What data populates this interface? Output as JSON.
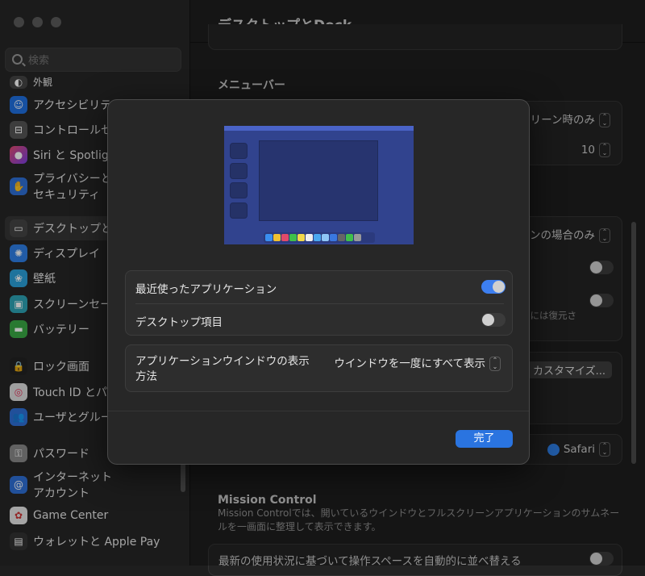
{
  "window": {
    "title": "デスクトップとDock"
  },
  "sidebar": {
    "search_placeholder": "検索",
    "items": [
      {
        "label": "外観",
        "icon": "appearance-icon",
        "color": "#444"
      },
      {
        "label": "アクセシビリティ",
        "icon": "accessibility-icon",
        "color": "#1f6fe0"
      },
      {
        "label": "コントロールセンター",
        "icon": "control-center-icon",
        "color": "#555"
      },
      {
        "label": "Siri と Spotlight",
        "icon": "siri-icon",
        "color": "#c43aa6"
      },
      {
        "label_line1": "プライバシーと",
        "label_line2": "セキュリティ",
        "icon": "hand-icon",
        "color": "#2f6fd6"
      },
      {
        "label": "デスクトップとDock",
        "icon": "dock-icon",
        "color": "#444"
      },
      {
        "label": "ディスプレイ",
        "icon": "display-icon",
        "color": "#2f7fe6"
      },
      {
        "label": "壁紙",
        "icon": "wallpaper-icon",
        "color": "#2aa0d8"
      },
      {
        "label": "スクリーンセーバ",
        "icon": "screensaver-icon",
        "color": "#2da3b5"
      },
      {
        "label": "バッテリー",
        "icon": "battery-icon",
        "color": "#3aa845"
      },
      {
        "label": "ロック画面",
        "icon": "lock-icon",
        "color": "#222"
      },
      {
        "label": "Touch ID とパスワード",
        "icon": "fingerprint-icon",
        "color": "#ddd"
      },
      {
        "label": "ユーザとグループ",
        "icon": "users-icon",
        "color": "#2f6fd6"
      },
      {
        "label": "パスワード",
        "icon": "key-icon",
        "color": "#888"
      },
      {
        "label_line1": "インターネット",
        "label_line2": "アカウント",
        "icon": "at-icon",
        "color": "#2f6fd6"
      },
      {
        "label": "Game Center",
        "icon": "game-center-icon",
        "color": "#e5e5e5"
      },
      {
        "label": "ウォレットと Apple Pay",
        "icon": "wallet-icon",
        "color": "#333"
      }
    ]
  },
  "main": {
    "menubar_title": "メニューバー",
    "menubar_value1": "リーン時のみ",
    "menubar_value2": "10",
    "right_value3": "ンの場合のみ",
    "restore_text": "には復元さ",
    "customize_label": "カスタマイズ...",
    "browser_label": "Safari",
    "mission_control_title": "Mission Control",
    "mission_control_desc": "Mission Controlでは、開いているウインドウとフルスクリーンアプリケーションのサムネールを一画面に整理して表示できます。",
    "auto_arrange_label": "最新の使用状況に基づいて操作スペースを自動的に並べ替える"
  },
  "modal": {
    "recent_apps_label": "最近使ったアプリケーション",
    "recent_apps_on": true,
    "desktop_items_label": "デスクトップ項目",
    "desktop_items_on": false,
    "window_display_label": "アプリケーションウインドウの表示方法",
    "window_display_value": "ウインドウを一度にすべて表示",
    "done_label": "完了"
  },
  "colors": {
    "accent": "#3d7ff0",
    "done_button": "#2a74e0",
    "preview_bg": "#31438e"
  }
}
